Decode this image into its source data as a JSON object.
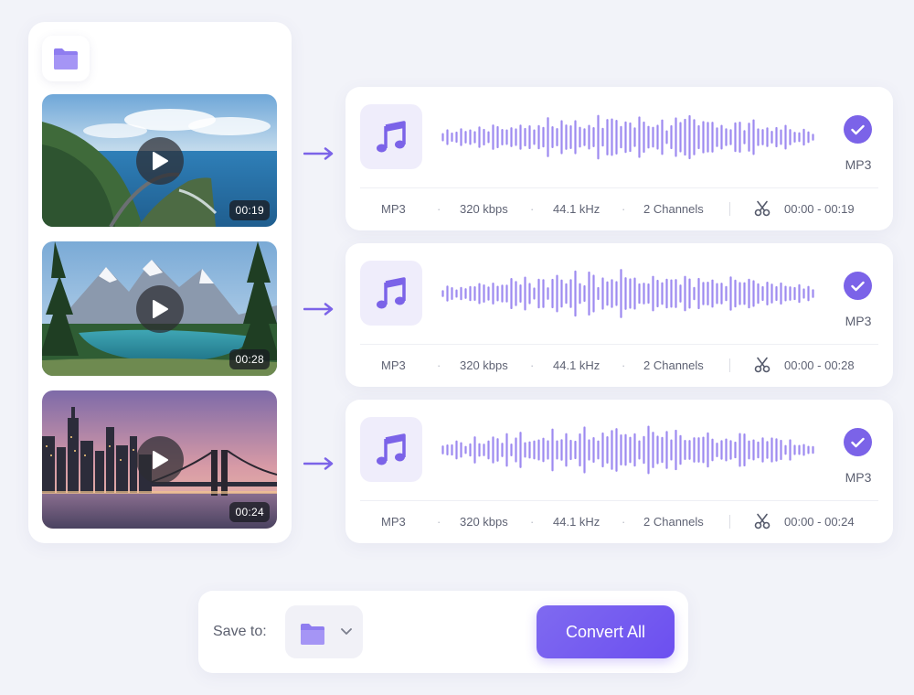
{
  "colors": {
    "accent": "#7b63e8",
    "wave": "#9d8af0",
    "background": "#f2f3f9"
  },
  "icons": {
    "add_folder": "folder-icon",
    "play": "play-icon",
    "audio": "music-note-icon",
    "done": "checkmark-icon",
    "trim": "scissors-icon",
    "dropdown": "chevron-down-icon"
  },
  "videos": [
    {
      "scene": "coastal road",
      "duration": "00:19"
    },
    {
      "scene": "mountain lake",
      "duration": "00:28"
    },
    {
      "scene": "city skyline bridge",
      "duration": "00:24"
    }
  ],
  "outputs": [
    {
      "format": "MP3",
      "meta_format": "MP3",
      "bitrate": "320 kbps",
      "sample_rate": "44.1 kHz",
      "channels": "2 Channels",
      "range": "00:00 - 00:19",
      "selected": true
    },
    {
      "format": "MP3",
      "meta_format": "MP3",
      "bitrate": "320 kbps",
      "sample_rate": "44.1 kHz",
      "channels": "2 Channels",
      "range": "00:00 - 00:28",
      "selected": true
    },
    {
      "format": "MP3",
      "meta_format": "MP3",
      "bitrate": "320 kbps",
      "sample_rate": "44.1 kHz",
      "channels": "2 Channels",
      "range": "00:00 - 00:24",
      "selected": true
    }
  ],
  "footer": {
    "save_label": "Save to:",
    "convert_label": "Convert All"
  }
}
